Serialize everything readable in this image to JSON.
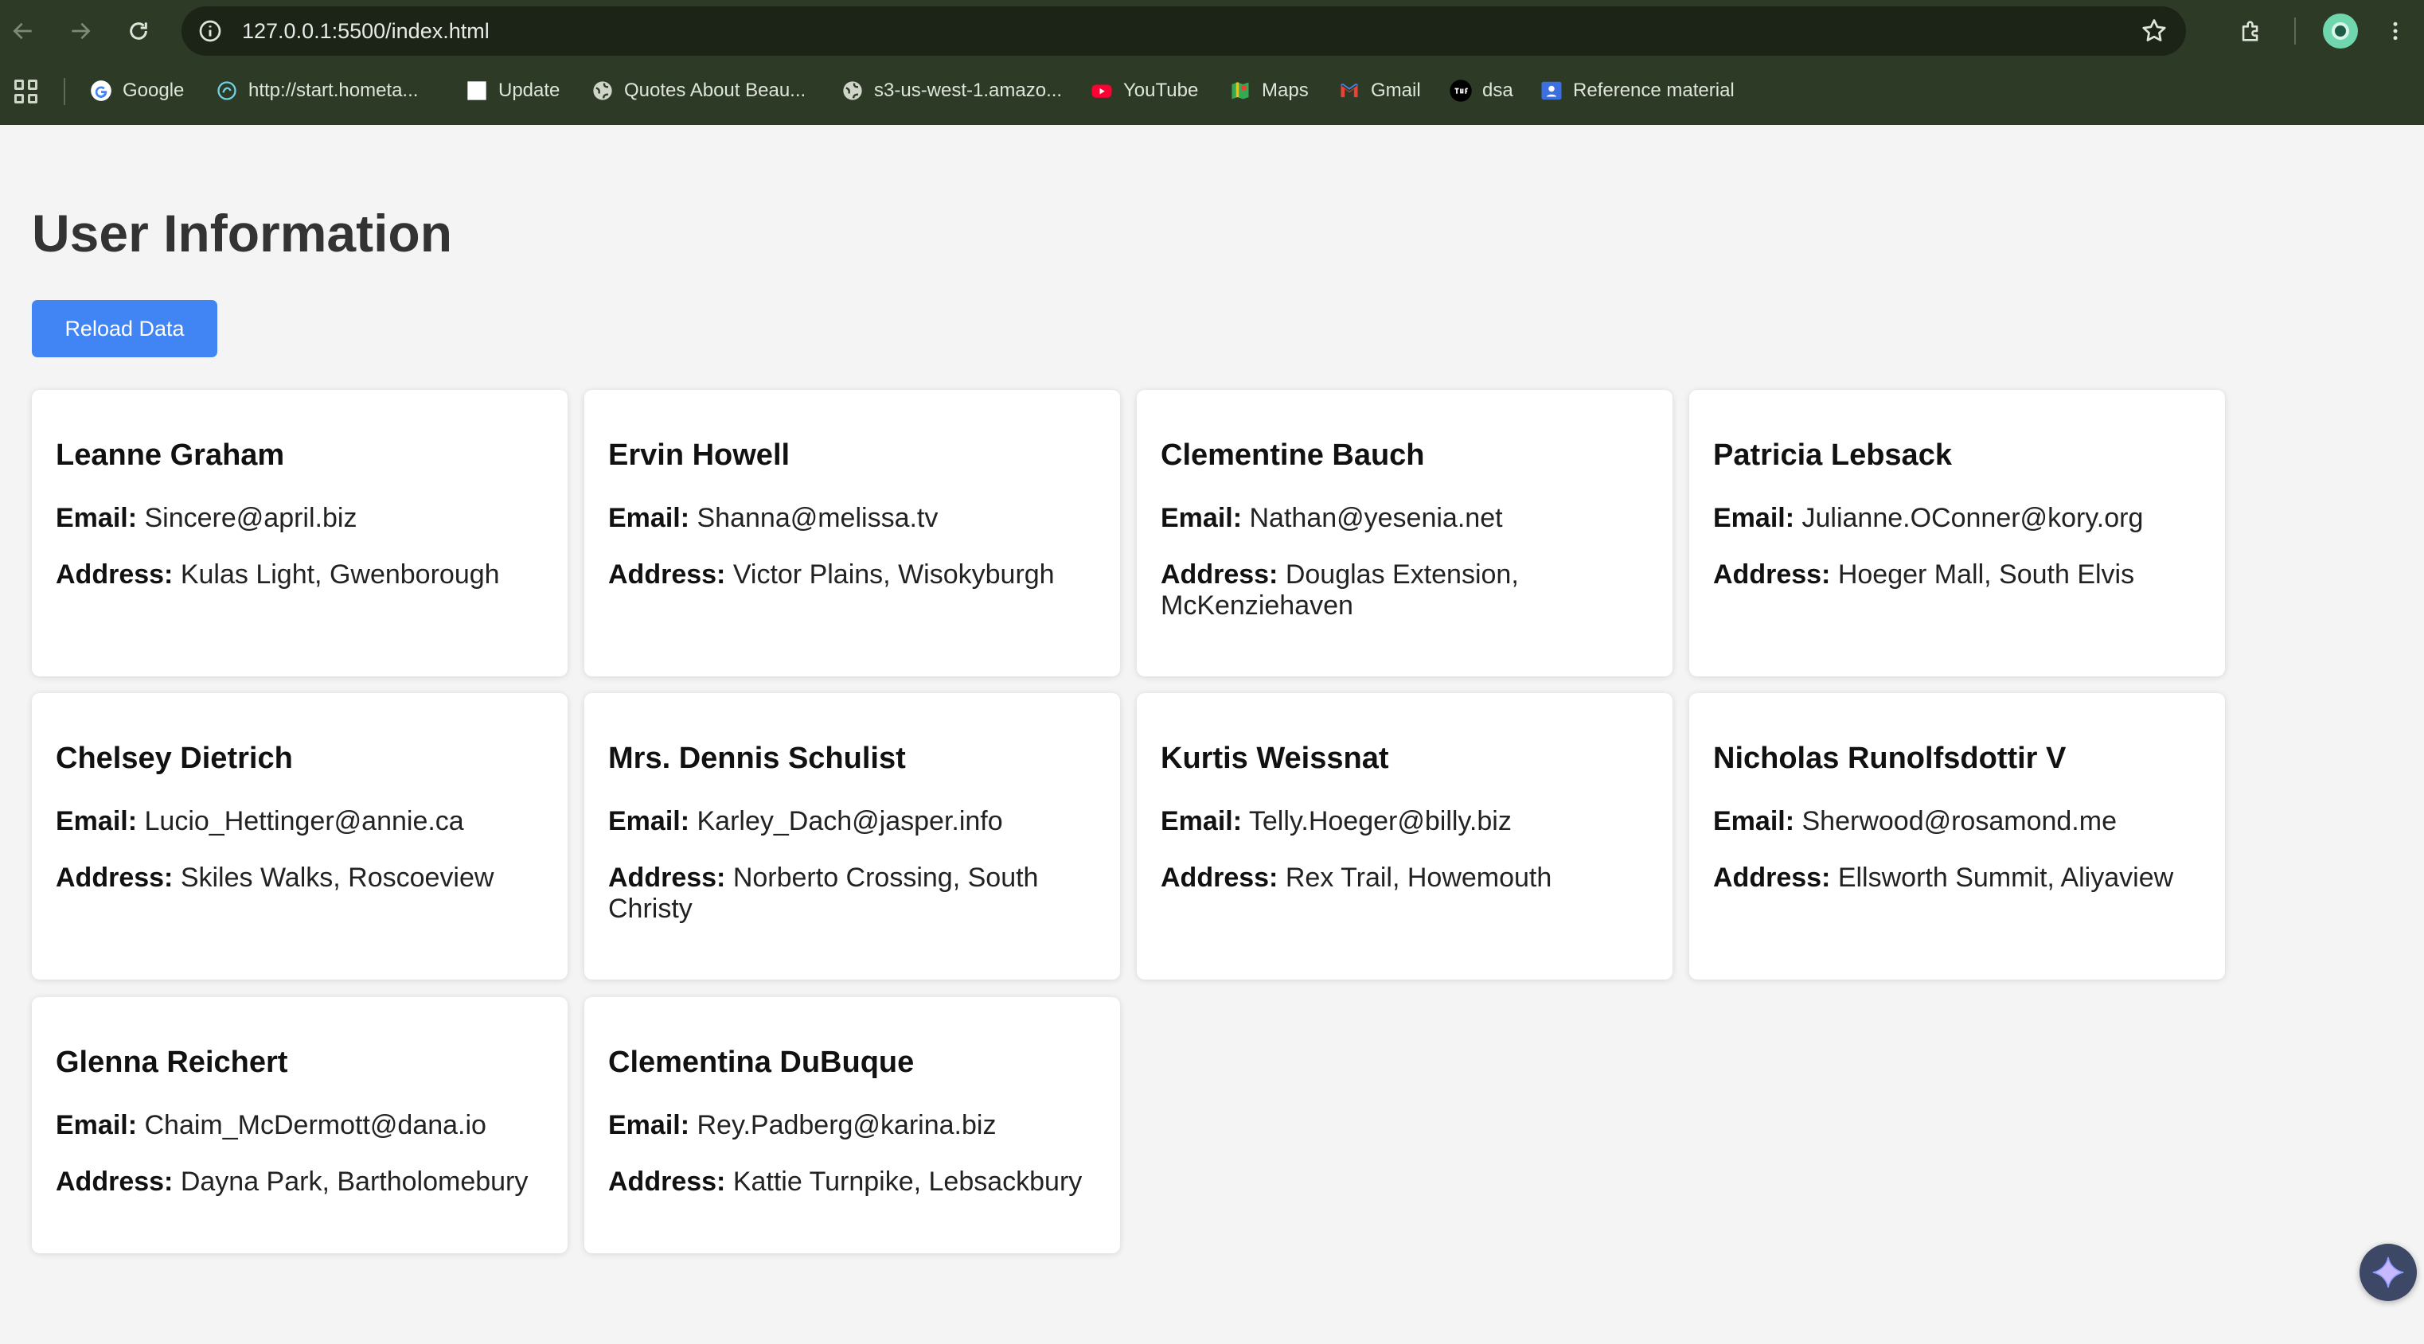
{
  "browser": {
    "url": "127.0.0.1:5500/index.html",
    "bookmarks": [
      {
        "label": "Google",
        "icon": "google-icon"
      },
      {
        "label": "http://start.hometa...",
        "icon": "globe-swirl-icon"
      },
      {
        "label": "Update",
        "icon": "white-square-icon"
      },
      {
        "label": "Quotes About Beau...",
        "icon": "globe-icon"
      },
      {
        "label": "s3-us-west-1.amazo...",
        "icon": "globe-icon"
      },
      {
        "label": "YouTube",
        "icon": "youtube-icon"
      },
      {
        "label": "Maps",
        "icon": "maps-icon"
      },
      {
        "label": "Gmail",
        "icon": "gmail-icon"
      },
      {
        "label": "dsa",
        "icon": "tuf-icon"
      },
      {
        "label": "Reference material",
        "icon": "classroom-icon"
      }
    ]
  },
  "page": {
    "title": "User Information",
    "reload_label": "Reload Data",
    "email_label": "Email:",
    "address_label": "Address:",
    "users": [
      {
        "name": "Leanne Graham",
        "email": "Sincere@april.biz",
        "address": "Kulas Light, Gwenborough"
      },
      {
        "name": "Ervin Howell",
        "email": "Shanna@melissa.tv",
        "address": "Victor Plains, Wisokyburgh"
      },
      {
        "name": "Clementine Bauch",
        "email": "Nathan@yesenia.net",
        "address": "Douglas Extension, McKenziehaven"
      },
      {
        "name": "Patricia Lebsack",
        "email": "Julianne.OConner@kory.org",
        "address": "Hoeger Mall, South Elvis"
      },
      {
        "name": "Chelsey Dietrich",
        "email": "Lucio_Hettinger@annie.ca",
        "address": "Skiles Walks, Roscoeview"
      },
      {
        "name": "Mrs. Dennis Schulist",
        "email": "Karley_Dach@jasper.info",
        "address": "Norberto Crossing, South Christy"
      },
      {
        "name": "Kurtis Weissnat",
        "email": "Telly.Hoeger@billy.biz",
        "address": "Rex Trail, Howemouth"
      },
      {
        "name": "Nicholas Runolfsdottir V",
        "email": "Sherwood@rosamond.me",
        "address": "Ellsworth Summit, Aliyaview"
      },
      {
        "name": "Glenna Reichert",
        "email": "Chaim_McDermott@dana.io",
        "address": "Dayna Park, Bartholomebury"
      },
      {
        "name": "Clementina DuBuque",
        "email": "Rey.Padberg@karina.biz",
        "address": "Kattie Turnpike, Lebsackbury"
      }
    ]
  },
  "colors": {
    "chrome_bg": "#2c3a26",
    "page_bg": "#f4f4f4",
    "button_blue": "#4185f4",
    "card_bg": "#ffffff"
  }
}
